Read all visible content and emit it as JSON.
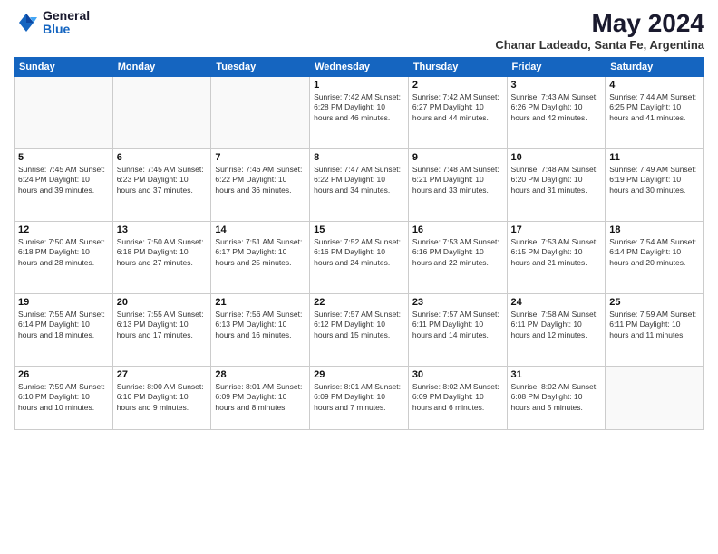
{
  "header": {
    "logo": {
      "general": "General",
      "blue": "Blue"
    },
    "title": "May 2024",
    "location": "Chanar Ladeado, Santa Fe, Argentina"
  },
  "weekdays": [
    "Sunday",
    "Monday",
    "Tuesday",
    "Wednesday",
    "Thursday",
    "Friday",
    "Saturday"
  ],
  "weeks": [
    [
      {
        "day": "",
        "info": ""
      },
      {
        "day": "",
        "info": ""
      },
      {
        "day": "",
        "info": ""
      },
      {
        "day": "1",
        "info": "Sunrise: 7:42 AM\nSunset: 6:28 PM\nDaylight: 10 hours\nand 46 minutes."
      },
      {
        "day": "2",
        "info": "Sunrise: 7:42 AM\nSunset: 6:27 PM\nDaylight: 10 hours\nand 44 minutes."
      },
      {
        "day": "3",
        "info": "Sunrise: 7:43 AM\nSunset: 6:26 PM\nDaylight: 10 hours\nand 42 minutes."
      },
      {
        "day": "4",
        "info": "Sunrise: 7:44 AM\nSunset: 6:25 PM\nDaylight: 10 hours\nand 41 minutes."
      }
    ],
    [
      {
        "day": "5",
        "info": "Sunrise: 7:45 AM\nSunset: 6:24 PM\nDaylight: 10 hours\nand 39 minutes."
      },
      {
        "day": "6",
        "info": "Sunrise: 7:45 AM\nSunset: 6:23 PM\nDaylight: 10 hours\nand 37 minutes."
      },
      {
        "day": "7",
        "info": "Sunrise: 7:46 AM\nSunset: 6:22 PM\nDaylight: 10 hours\nand 36 minutes."
      },
      {
        "day": "8",
        "info": "Sunrise: 7:47 AM\nSunset: 6:22 PM\nDaylight: 10 hours\nand 34 minutes."
      },
      {
        "day": "9",
        "info": "Sunrise: 7:48 AM\nSunset: 6:21 PM\nDaylight: 10 hours\nand 33 minutes."
      },
      {
        "day": "10",
        "info": "Sunrise: 7:48 AM\nSunset: 6:20 PM\nDaylight: 10 hours\nand 31 minutes."
      },
      {
        "day": "11",
        "info": "Sunrise: 7:49 AM\nSunset: 6:19 PM\nDaylight: 10 hours\nand 30 minutes."
      }
    ],
    [
      {
        "day": "12",
        "info": "Sunrise: 7:50 AM\nSunset: 6:18 PM\nDaylight: 10 hours\nand 28 minutes."
      },
      {
        "day": "13",
        "info": "Sunrise: 7:50 AM\nSunset: 6:18 PM\nDaylight: 10 hours\nand 27 minutes."
      },
      {
        "day": "14",
        "info": "Sunrise: 7:51 AM\nSunset: 6:17 PM\nDaylight: 10 hours\nand 25 minutes."
      },
      {
        "day": "15",
        "info": "Sunrise: 7:52 AM\nSunset: 6:16 PM\nDaylight: 10 hours\nand 24 minutes."
      },
      {
        "day": "16",
        "info": "Sunrise: 7:53 AM\nSunset: 6:16 PM\nDaylight: 10 hours\nand 22 minutes."
      },
      {
        "day": "17",
        "info": "Sunrise: 7:53 AM\nSunset: 6:15 PM\nDaylight: 10 hours\nand 21 minutes."
      },
      {
        "day": "18",
        "info": "Sunrise: 7:54 AM\nSunset: 6:14 PM\nDaylight: 10 hours\nand 20 minutes."
      }
    ],
    [
      {
        "day": "19",
        "info": "Sunrise: 7:55 AM\nSunset: 6:14 PM\nDaylight: 10 hours\nand 18 minutes."
      },
      {
        "day": "20",
        "info": "Sunrise: 7:55 AM\nSunset: 6:13 PM\nDaylight: 10 hours\nand 17 minutes."
      },
      {
        "day": "21",
        "info": "Sunrise: 7:56 AM\nSunset: 6:13 PM\nDaylight: 10 hours\nand 16 minutes."
      },
      {
        "day": "22",
        "info": "Sunrise: 7:57 AM\nSunset: 6:12 PM\nDaylight: 10 hours\nand 15 minutes."
      },
      {
        "day": "23",
        "info": "Sunrise: 7:57 AM\nSunset: 6:11 PM\nDaylight: 10 hours\nand 14 minutes."
      },
      {
        "day": "24",
        "info": "Sunrise: 7:58 AM\nSunset: 6:11 PM\nDaylight: 10 hours\nand 12 minutes."
      },
      {
        "day": "25",
        "info": "Sunrise: 7:59 AM\nSunset: 6:11 PM\nDaylight: 10 hours\nand 11 minutes."
      }
    ],
    [
      {
        "day": "26",
        "info": "Sunrise: 7:59 AM\nSunset: 6:10 PM\nDaylight: 10 hours\nand 10 minutes."
      },
      {
        "day": "27",
        "info": "Sunrise: 8:00 AM\nSunset: 6:10 PM\nDaylight: 10 hours\nand 9 minutes."
      },
      {
        "day": "28",
        "info": "Sunrise: 8:01 AM\nSunset: 6:09 PM\nDaylight: 10 hours\nand 8 minutes."
      },
      {
        "day": "29",
        "info": "Sunrise: 8:01 AM\nSunset: 6:09 PM\nDaylight: 10 hours\nand 7 minutes."
      },
      {
        "day": "30",
        "info": "Sunrise: 8:02 AM\nSunset: 6:09 PM\nDaylight: 10 hours\nand 6 minutes."
      },
      {
        "day": "31",
        "info": "Sunrise: 8:02 AM\nSunset: 6:08 PM\nDaylight: 10 hours\nand 5 minutes."
      },
      {
        "day": "",
        "info": ""
      }
    ]
  ]
}
